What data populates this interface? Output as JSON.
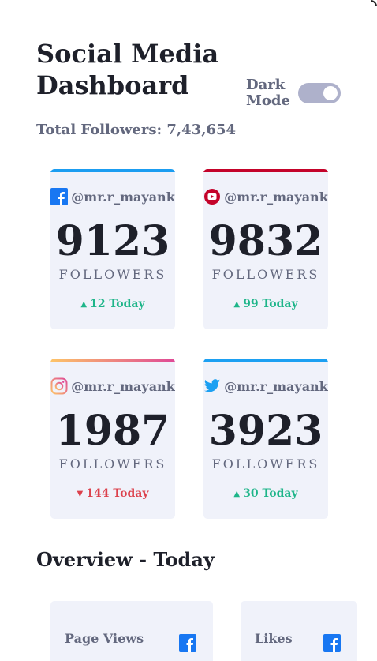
{
  "header": {
    "title": "Social Media Dashboard",
    "total_followers": "Total Followers: 7,43,654",
    "dark_mode_label": "Dark Mode",
    "dark_mode_on": true
  },
  "cards": [
    {
      "platform": "facebook",
      "icon": "facebook-icon",
      "handle": "@mr.r_mayank",
      "count": "9123",
      "label": "FOLLOWERS",
      "today": "12 Today",
      "trend": "up",
      "accent": "#1b9df1"
    },
    {
      "platform": "youtube",
      "icon": "youtube-icon",
      "handle": "@mr.r_mayank",
      "count": "9832",
      "label": "FOLLOWERS",
      "today": "99 Today",
      "trend": "up",
      "accent": "#c4032a"
    },
    {
      "platform": "instagram",
      "icon": "instagram-icon",
      "handle": "@mr.r_mayank",
      "count": "1987",
      "label": "FOLLOWERS",
      "today": "144 Today",
      "trend": "down",
      "accent": "#df4996"
    },
    {
      "platform": "twitter",
      "icon": "twitter-icon",
      "handle": "@mr.r_mayank",
      "count": "3923",
      "label": "FOLLOWERS",
      "today": "30 Today",
      "trend": "up",
      "accent": "#1ca0f2"
    }
  ],
  "overview": {
    "title": "Overview - Today",
    "items": [
      {
        "label": "Page Views",
        "icon": "facebook-icon"
      },
      {
        "label": "Likes",
        "icon": "facebook-icon"
      }
    ]
  },
  "colors": {
    "up": "#1eb589",
    "down": "#dc414c",
    "card_bg": "#f0f2fa",
    "toggle": "#aeb1cb"
  }
}
